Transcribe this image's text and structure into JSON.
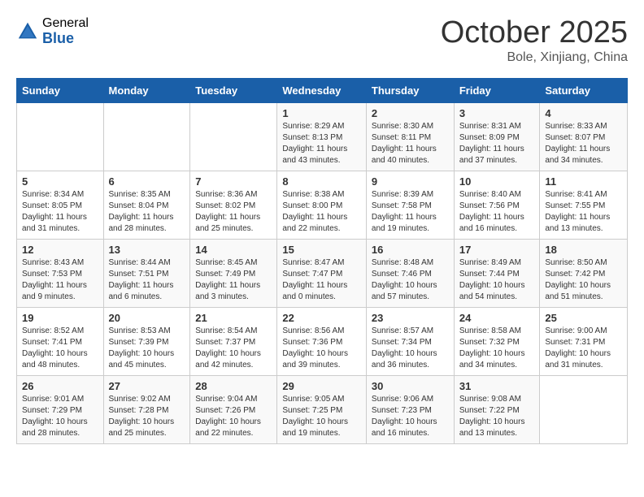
{
  "header": {
    "logo_general": "General",
    "logo_blue": "Blue",
    "month": "October 2025",
    "location": "Bole, Xinjiang, China"
  },
  "weekdays": [
    "Sunday",
    "Monday",
    "Tuesday",
    "Wednesday",
    "Thursday",
    "Friday",
    "Saturday"
  ],
  "weeks": [
    [
      {
        "day": "",
        "info": ""
      },
      {
        "day": "",
        "info": ""
      },
      {
        "day": "",
        "info": ""
      },
      {
        "day": "1",
        "info": "Sunrise: 8:29 AM\nSunset: 8:13 PM\nDaylight: 11 hours and 43 minutes."
      },
      {
        "day": "2",
        "info": "Sunrise: 8:30 AM\nSunset: 8:11 PM\nDaylight: 11 hours and 40 minutes."
      },
      {
        "day": "3",
        "info": "Sunrise: 8:31 AM\nSunset: 8:09 PM\nDaylight: 11 hours and 37 minutes."
      },
      {
        "day": "4",
        "info": "Sunrise: 8:33 AM\nSunset: 8:07 PM\nDaylight: 11 hours and 34 minutes."
      }
    ],
    [
      {
        "day": "5",
        "info": "Sunrise: 8:34 AM\nSunset: 8:05 PM\nDaylight: 11 hours and 31 minutes."
      },
      {
        "day": "6",
        "info": "Sunrise: 8:35 AM\nSunset: 8:04 PM\nDaylight: 11 hours and 28 minutes."
      },
      {
        "day": "7",
        "info": "Sunrise: 8:36 AM\nSunset: 8:02 PM\nDaylight: 11 hours and 25 minutes."
      },
      {
        "day": "8",
        "info": "Sunrise: 8:38 AM\nSunset: 8:00 PM\nDaylight: 11 hours and 22 minutes."
      },
      {
        "day": "9",
        "info": "Sunrise: 8:39 AM\nSunset: 7:58 PM\nDaylight: 11 hours and 19 minutes."
      },
      {
        "day": "10",
        "info": "Sunrise: 8:40 AM\nSunset: 7:56 PM\nDaylight: 11 hours and 16 minutes."
      },
      {
        "day": "11",
        "info": "Sunrise: 8:41 AM\nSunset: 7:55 PM\nDaylight: 11 hours and 13 minutes."
      }
    ],
    [
      {
        "day": "12",
        "info": "Sunrise: 8:43 AM\nSunset: 7:53 PM\nDaylight: 11 hours and 9 minutes."
      },
      {
        "day": "13",
        "info": "Sunrise: 8:44 AM\nSunset: 7:51 PM\nDaylight: 11 hours and 6 minutes."
      },
      {
        "day": "14",
        "info": "Sunrise: 8:45 AM\nSunset: 7:49 PM\nDaylight: 11 hours and 3 minutes."
      },
      {
        "day": "15",
        "info": "Sunrise: 8:47 AM\nSunset: 7:47 PM\nDaylight: 11 hours and 0 minutes."
      },
      {
        "day": "16",
        "info": "Sunrise: 8:48 AM\nSunset: 7:46 PM\nDaylight: 10 hours and 57 minutes."
      },
      {
        "day": "17",
        "info": "Sunrise: 8:49 AM\nSunset: 7:44 PM\nDaylight: 10 hours and 54 minutes."
      },
      {
        "day": "18",
        "info": "Sunrise: 8:50 AM\nSunset: 7:42 PM\nDaylight: 10 hours and 51 minutes."
      }
    ],
    [
      {
        "day": "19",
        "info": "Sunrise: 8:52 AM\nSunset: 7:41 PM\nDaylight: 10 hours and 48 minutes."
      },
      {
        "day": "20",
        "info": "Sunrise: 8:53 AM\nSunset: 7:39 PM\nDaylight: 10 hours and 45 minutes."
      },
      {
        "day": "21",
        "info": "Sunrise: 8:54 AM\nSunset: 7:37 PM\nDaylight: 10 hours and 42 minutes."
      },
      {
        "day": "22",
        "info": "Sunrise: 8:56 AM\nSunset: 7:36 PM\nDaylight: 10 hours and 39 minutes."
      },
      {
        "day": "23",
        "info": "Sunrise: 8:57 AM\nSunset: 7:34 PM\nDaylight: 10 hours and 36 minutes."
      },
      {
        "day": "24",
        "info": "Sunrise: 8:58 AM\nSunset: 7:32 PM\nDaylight: 10 hours and 34 minutes."
      },
      {
        "day": "25",
        "info": "Sunrise: 9:00 AM\nSunset: 7:31 PM\nDaylight: 10 hours and 31 minutes."
      }
    ],
    [
      {
        "day": "26",
        "info": "Sunrise: 9:01 AM\nSunset: 7:29 PM\nDaylight: 10 hours and 28 minutes."
      },
      {
        "day": "27",
        "info": "Sunrise: 9:02 AM\nSunset: 7:28 PM\nDaylight: 10 hours and 25 minutes."
      },
      {
        "day": "28",
        "info": "Sunrise: 9:04 AM\nSunset: 7:26 PM\nDaylight: 10 hours and 22 minutes."
      },
      {
        "day": "29",
        "info": "Sunrise: 9:05 AM\nSunset: 7:25 PM\nDaylight: 10 hours and 19 minutes."
      },
      {
        "day": "30",
        "info": "Sunrise: 9:06 AM\nSunset: 7:23 PM\nDaylight: 10 hours and 16 minutes."
      },
      {
        "day": "31",
        "info": "Sunrise: 9:08 AM\nSunset: 7:22 PM\nDaylight: 10 hours and 13 minutes."
      },
      {
        "day": "",
        "info": ""
      }
    ]
  ]
}
